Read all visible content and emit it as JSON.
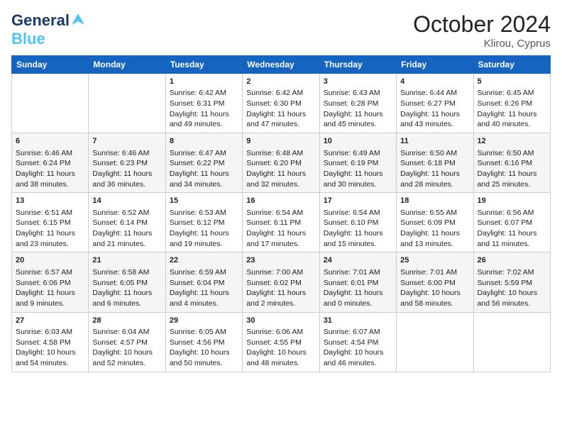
{
  "logo": {
    "line1": "General",
    "line2": "Blue",
    "tagline": ""
  },
  "header": {
    "month": "October 2024",
    "location": "Klirou, Cyprus"
  },
  "weekdays": [
    "Sunday",
    "Monday",
    "Tuesday",
    "Wednesday",
    "Thursday",
    "Friday",
    "Saturday"
  ],
  "weeks": [
    [
      {
        "day": "",
        "sunrise": "",
        "sunset": "",
        "daylight": ""
      },
      {
        "day": "",
        "sunrise": "",
        "sunset": "",
        "daylight": ""
      },
      {
        "day": "1",
        "sunrise": "Sunrise: 6:42 AM",
        "sunset": "Sunset: 6:31 PM",
        "daylight": "Daylight: 11 hours and 49 minutes."
      },
      {
        "day": "2",
        "sunrise": "Sunrise: 6:42 AM",
        "sunset": "Sunset: 6:30 PM",
        "daylight": "Daylight: 11 hours and 47 minutes."
      },
      {
        "day": "3",
        "sunrise": "Sunrise: 6:43 AM",
        "sunset": "Sunset: 6:28 PM",
        "daylight": "Daylight: 11 hours and 45 minutes."
      },
      {
        "day": "4",
        "sunrise": "Sunrise: 6:44 AM",
        "sunset": "Sunset: 6:27 PM",
        "daylight": "Daylight: 11 hours and 43 minutes."
      },
      {
        "day": "5",
        "sunrise": "Sunrise: 6:45 AM",
        "sunset": "Sunset: 6:26 PM",
        "daylight": "Daylight: 11 hours and 40 minutes."
      }
    ],
    [
      {
        "day": "6",
        "sunrise": "Sunrise: 6:46 AM",
        "sunset": "Sunset: 6:24 PM",
        "daylight": "Daylight: 11 hours and 38 minutes."
      },
      {
        "day": "7",
        "sunrise": "Sunrise: 6:46 AM",
        "sunset": "Sunset: 6:23 PM",
        "daylight": "Daylight: 11 hours and 36 minutes."
      },
      {
        "day": "8",
        "sunrise": "Sunrise: 6:47 AM",
        "sunset": "Sunset: 6:22 PM",
        "daylight": "Daylight: 11 hours and 34 minutes."
      },
      {
        "day": "9",
        "sunrise": "Sunrise: 6:48 AM",
        "sunset": "Sunset: 6:20 PM",
        "daylight": "Daylight: 11 hours and 32 minutes."
      },
      {
        "day": "10",
        "sunrise": "Sunrise: 6:49 AM",
        "sunset": "Sunset: 6:19 PM",
        "daylight": "Daylight: 11 hours and 30 minutes."
      },
      {
        "day": "11",
        "sunrise": "Sunrise: 6:50 AM",
        "sunset": "Sunset: 6:18 PM",
        "daylight": "Daylight: 11 hours and 28 minutes."
      },
      {
        "day": "12",
        "sunrise": "Sunrise: 6:50 AM",
        "sunset": "Sunset: 6:16 PM",
        "daylight": "Daylight: 11 hours and 25 minutes."
      }
    ],
    [
      {
        "day": "13",
        "sunrise": "Sunrise: 6:51 AM",
        "sunset": "Sunset: 6:15 PM",
        "daylight": "Daylight: 11 hours and 23 minutes."
      },
      {
        "day": "14",
        "sunrise": "Sunrise: 6:52 AM",
        "sunset": "Sunset: 6:14 PM",
        "daylight": "Daylight: 11 hours and 21 minutes."
      },
      {
        "day": "15",
        "sunrise": "Sunrise: 6:53 AM",
        "sunset": "Sunset: 6:12 PM",
        "daylight": "Daylight: 11 hours and 19 minutes."
      },
      {
        "day": "16",
        "sunrise": "Sunrise: 6:54 AM",
        "sunset": "Sunset: 6:11 PM",
        "daylight": "Daylight: 11 hours and 17 minutes."
      },
      {
        "day": "17",
        "sunrise": "Sunrise: 6:54 AM",
        "sunset": "Sunset: 6:10 PM",
        "daylight": "Daylight: 11 hours and 15 minutes."
      },
      {
        "day": "18",
        "sunrise": "Sunrise: 6:55 AM",
        "sunset": "Sunset: 6:09 PM",
        "daylight": "Daylight: 11 hours and 13 minutes."
      },
      {
        "day": "19",
        "sunrise": "Sunrise: 6:56 AM",
        "sunset": "Sunset: 6:07 PM",
        "daylight": "Daylight: 11 hours and 11 minutes."
      }
    ],
    [
      {
        "day": "20",
        "sunrise": "Sunrise: 6:57 AM",
        "sunset": "Sunset: 6:06 PM",
        "daylight": "Daylight: 11 hours and 9 minutes."
      },
      {
        "day": "21",
        "sunrise": "Sunrise: 6:58 AM",
        "sunset": "Sunset: 6:05 PM",
        "daylight": "Daylight: 11 hours and 6 minutes."
      },
      {
        "day": "22",
        "sunrise": "Sunrise: 6:59 AM",
        "sunset": "Sunset: 6:04 PM",
        "daylight": "Daylight: 11 hours and 4 minutes."
      },
      {
        "day": "23",
        "sunrise": "Sunrise: 7:00 AM",
        "sunset": "Sunset: 6:02 PM",
        "daylight": "Daylight: 11 hours and 2 minutes."
      },
      {
        "day": "24",
        "sunrise": "Sunrise: 7:01 AM",
        "sunset": "Sunset: 6:01 PM",
        "daylight": "Daylight: 11 hours and 0 minutes."
      },
      {
        "day": "25",
        "sunrise": "Sunrise: 7:01 AM",
        "sunset": "Sunset: 6:00 PM",
        "daylight": "Daylight: 10 hours and 58 minutes."
      },
      {
        "day": "26",
        "sunrise": "Sunrise: 7:02 AM",
        "sunset": "Sunset: 5:59 PM",
        "daylight": "Daylight: 10 hours and 56 minutes."
      }
    ],
    [
      {
        "day": "27",
        "sunrise": "Sunrise: 6:03 AM",
        "sunset": "Sunset: 4:58 PM",
        "daylight": "Daylight: 10 hours and 54 minutes."
      },
      {
        "day": "28",
        "sunrise": "Sunrise: 6:04 AM",
        "sunset": "Sunset: 4:57 PM",
        "daylight": "Daylight: 10 hours and 52 minutes."
      },
      {
        "day": "29",
        "sunrise": "Sunrise: 6:05 AM",
        "sunset": "Sunset: 4:56 PM",
        "daylight": "Daylight: 10 hours and 50 minutes."
      },
      {
        "day": "30",
        "sunrise": "Sunrise: 6:06 AM",
        "sunset": "Sunset: 4:55 PM",
        "daylight": "Daylight: 10 hours and 48 minutes."
      },
      {
        "day": "31",
        "sunrise": "Sunrise: 6:07 AM",
        "sunset": "Sunset: 4:54 PM",
        "daylight": "Daylight: 10 hours and 46 minutes."
      },
      {
        "day": "",
        "sunrise": "",
        "sunset": "",
        "daylight": ""
      },
      {
        "day": "",
        "sunrise": "",
        "sunset": "",
        "daylight": ""
      }
    ]
  ]
}
